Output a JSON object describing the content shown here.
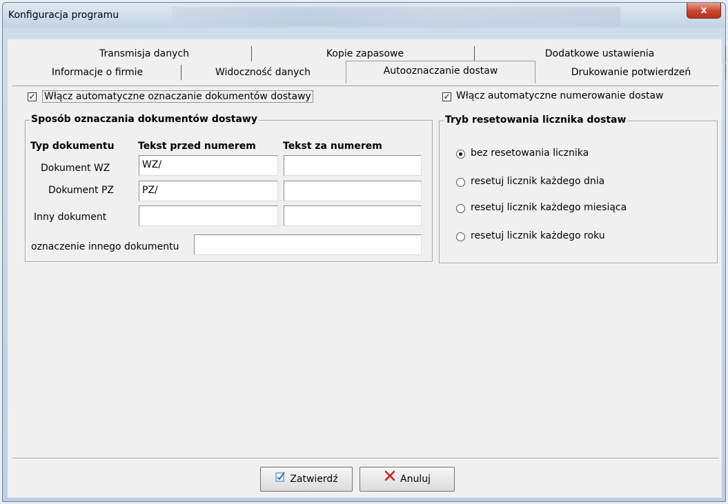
{
  "window": {
    "title": "Konfiguracja programu",
    "close": "x"
  },
  "tabs_top": [
    "Transmisja danych",
    "Kopie zapasowe",
    "Dodatkowe ustawienia"
  ],
  "tabs_bottom": [
    "Informacje o firmie",
    "Widoczność danych",
    "Autooznaczanie dostaw",
    "Drukowanie potwierdzeń"
  ],
  "active_tab": "Autooznaczanie dostaw",
  "auto_mark": {
    "label": "Włącz automatyczne oznaczanie dokumentów dostawy",
    "checked": true,
    "mark": "✓"
  },
  "auto_number": {
    "label": "Włącz automatyczne numerowanie dostaw",
    "checked": true,
    "mark": "✓"
  },
  "marking_group": {
    "title": "Sposób oznaczania dokumentów dostawy",
    "headers": {
      "type": "Typ dokumentu",
      "before": "Tekst przed numerem",
      "after": "Tekst za numerem"
    },
    "rows": [
      {
        "label": "Dokument WZ",
        "before": "WZ/",
        "after": ""
      },
      {
        "label": "Dokument PZ",
        "before": "PZ/",
        "after": ""
      },
      {
        "label": "Inny dokument",
        "before": "",
        "after": ""
      }
    ],
    "other_label": "oznaczenie innego dokumentu",
    "other_value": ""
  },
  "reset_group": {
    "title": "Tryb resetowania licznika dostaw",
    "options": [
      "bez resetowania licznika",
      "resetuj licznik każdego dnia",
      "resetuj licznik każdego miesiąca",
      "resetuj licznik każdego roku"
    ],
    "selected": "bez resetowania licznika"
  },
  "buttons": {
    "ok": "Zatwierdź",
    "cancel": "Anuluj"
  },
  "colors": {
    "cancel_x": "#d2231a",
    "ok_icon": "#2f6fc6"
  }
}
